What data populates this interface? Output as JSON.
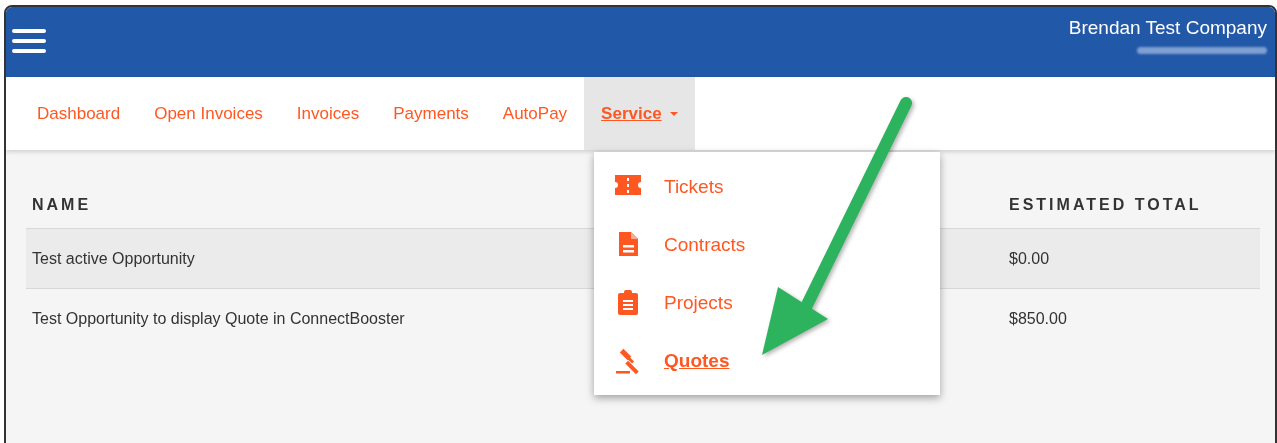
{
  "header": {
    "company": "Brendan Test Company",
    "account_blurred": true
  },
  "nav": {
    "tabs": [
      {
        "label": "Dashboard",
        "selected": false,
        "kind": "link"
      },
      {
        "label": "Open Invoices",
        "selected": false,
        "kind": "link"
      },
      {
        "label": "Invoices",
        "selected": false,
        "kind": "link"
      },
      {
        "label": "Payments",
        "selected": false,
        "kind": "link"
      },
      {
        "label": "AutoPay",
        "selected": false,
        "kind": "link"
      },
      {
        "label": "Service",
        "selected": true,
        "kind": "dropdown"
      }
    ]
  },
  "menu": {
    "items": [
      {
        "label": "Tickets",
        "kind": "ticket",
        "selected": false
      },
      {
        "label": "Contracts",
        "kind": "document",
        "selected": false
      },
      {
        "label": "Projects",
        "kind": "clipboard",
        "selected": false
      },
      {
        "label": "Quotes",
        "kind": "gavel",
        "selected": true
      }
    ]
  },
  "table": {
    "columns": [
      "NAME",
      "ESTIMATED TOTAL"
    ],
    "rows": [
      [
        "Test active Opportunity",
        "$0.00"
      ],
      [
        "Test Opportunity to display Quote in ConnectBooster",
        "$850.00"
      ]
    ]
  }
}
